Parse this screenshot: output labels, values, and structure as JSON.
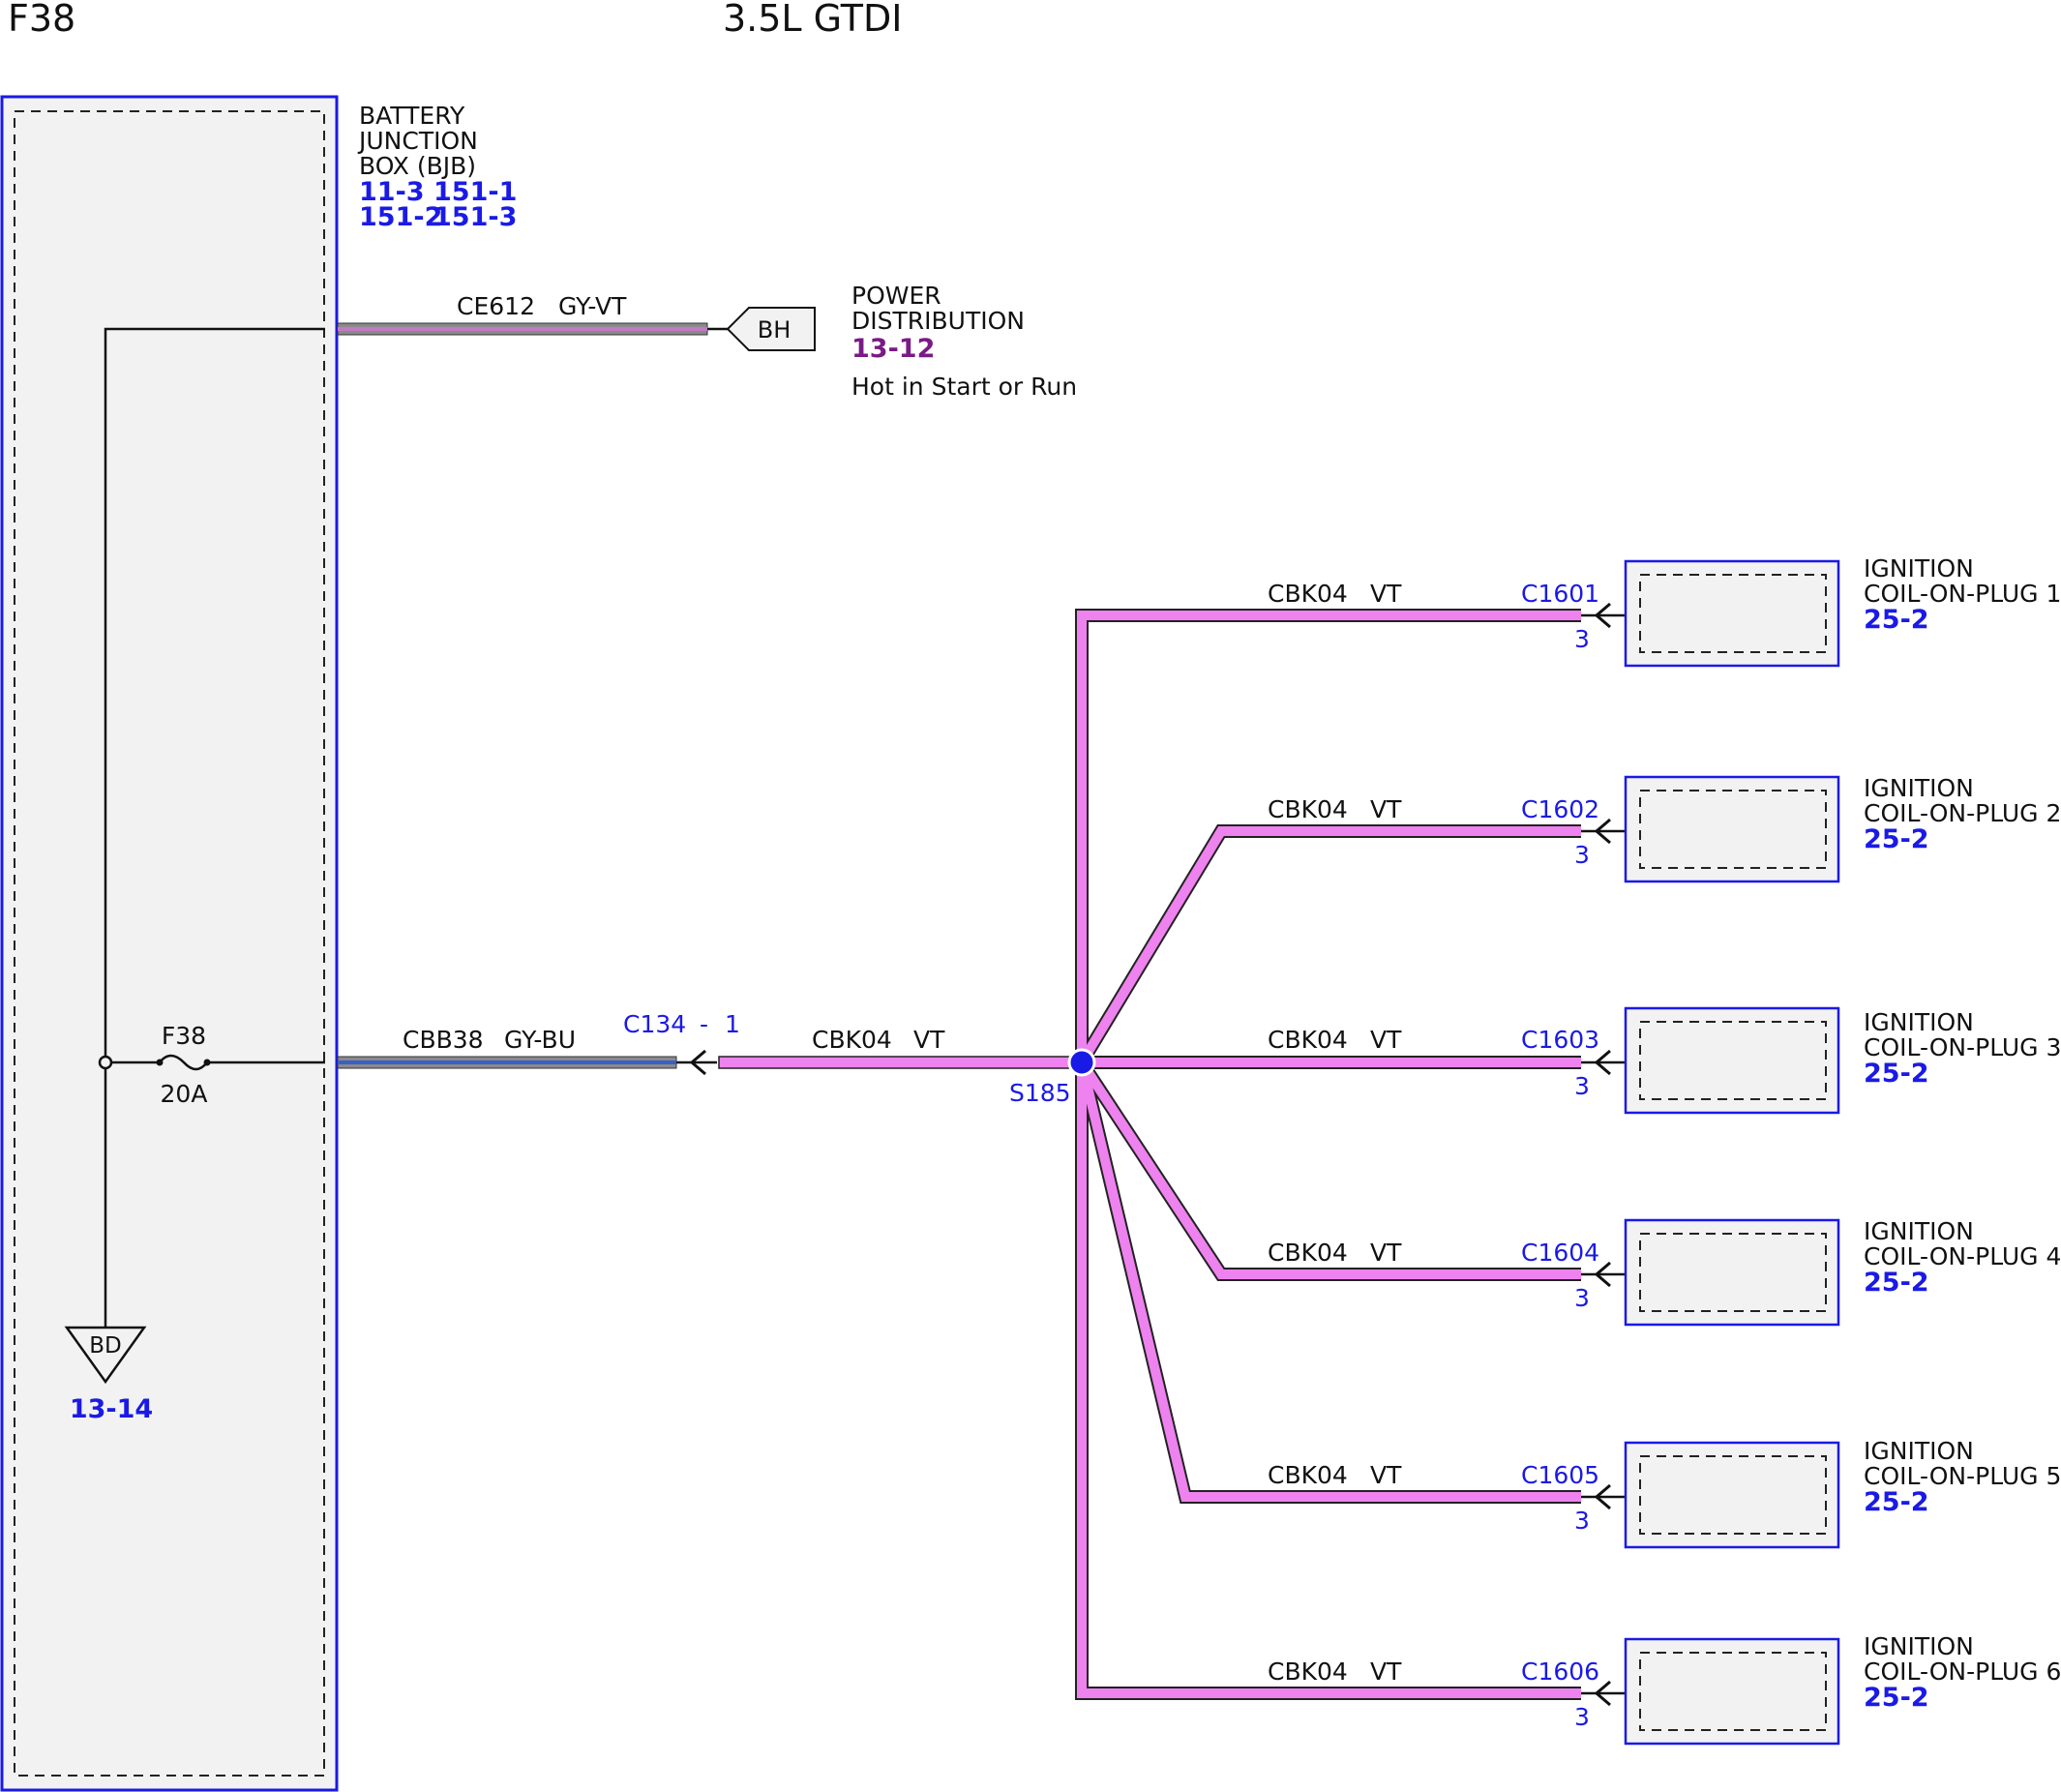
{
  "header": {
    "fuse_id": "F38",
    "engine": "3.5L GTDI"
  },
  "bjb": {
    "name_lines": [
      "BATTERY",
      "JUNCTION",
      "BOX (BJB)"
    ],
    "refs": [
      "11-3",
      "151-1",
      "151-2",
      "151-3"
    ]
  },
  "fuse": {
    "label": "F38",
    "rating": "20A"
  },
  "ground": {
    "label": "BD",
    "ref": "13-14"
  },
  "power_wire": {
    "circuit": "CE612",
    "color": "GY-VT",
    "connector": "BH"
  },
  "power_dist": {
    "line1": "POWER",
    "line2": "DISTRIBUTION",
    "ref": "13-12",
    "note": "Hot in Start or Run"
  },
  "main_wire": {
    "circuit": "CBB38",
    "color": "GY-BU",
    "connector": "C134",
    "dash": "-",
    "pin": "1"
  },
  "splice_wire": {
    "circuit": "CBK04",
    "color": "VT"
  },
  "splice": {
    "label": "S185"
  },
  "colors": {
    "violet": "#ee82ee",
    "wire_outline": "#222222",
    "blue": "#1a1ae6",
    "box_fill": "#f2f2f2",
    "purple": "#7a1a86"
  },
  "coils": [
    {
      "circuit": "CBK04",
      "color": "VT",
      "connector": "C1601",
      "pin": "3",
      "line1": "IGNITION",
      "line2": "COIL-ON-PLUG 1",
      "ref": "25-2"
    },
    {
      "circuit": "CBK04",
      "color": "VT",
      "connector": "C1602",
      "pin": "3",
      "line1": "IGNITION",
      "line2": "COIL-ON-PLUG 2",
      "ref": "25-2"
    },
    {
      "circuit": "CBK04",
      "color": "VT",
      "connector": "C1603",
      "pin": "3",
      "line1": "IGNITION",
      "line2": "COIL-ON-PLUG 3",
      "ref": "25-2"
    },
    {
      "circuit": "CBK04",
      "color": "VT",
      "connector": "C1604",
      "pin": "3",
      "line1": "IGNITION",
      "line2": "COIL-ON-PLUG 4",
      "ref": "25-2"
    },
    {
      "circuit": "CBK04",
      "color": "VT",
      "connector": "C1605",
      "pin": "3",
      "line1": "IGNITION",
      "line2": "COIL-ON-PLUG 5",
      "ref": "25-2"
    },
    {
      "circuit": "CBK04",
      "color": "VT",
      "connector": "C1606",
      "pin": "3",
      "line1": "IGNITION",
      "line2": "COIL-ON-PLUG 6",
      "ref": "25-2"
    }
  ]
}
